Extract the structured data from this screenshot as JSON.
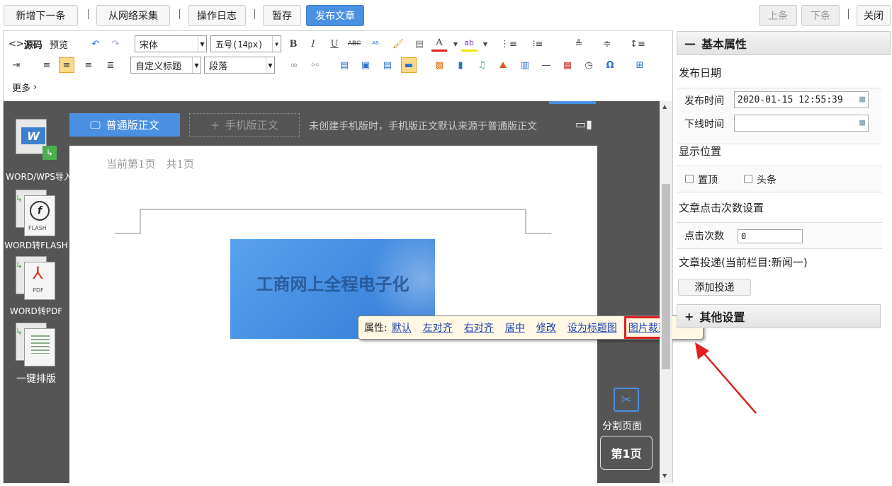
{
  "topbar": {
    "add_next": "新增下一条",
    "collect": "从网络采集",
    "log": "操作日志",
    "draft": "暂存",
    "publish": "发布文章",
    "prev": "上条",
    "next": "下条",
    "close": "关闭"
  },
  "editor_toolbar": {
    "source": "源码",
    "preview": "预览",
    "font_family": "宋体",
    "font_size": "五号(14px)",
    "custom_heading": "自定义标题",
    "paragraph": "段落",
    "more": "更多"
  },
  "left_tools": [
    {
      "label": "WORD/WPS导入",
      "icon": "word-import-icon"
    },
    {
      "label": "WORD转FLASH",
      "icon": "word-to-flash-icon"
    },
    {
      "label": "WORD转PDF",
      "icon": "word-to-pdf-icon"
    },
    {
      "label": "一键排版",
      "icon": "auto-format-icon"
    }
  ],
  "tabs": {
    "normal": "普通版正文",
    "mobile": "手机版正文",
    "hint": "未创建手机版时，手机版正文默认来源于普通版正文"
  },
  "page": {
    "info": "当前第1页　共1页",
    "image_text": "工商网上全程电子化"
  },
  "popup": {
    "label": "属性:",
    "links": [
      "默认",
      "左对齐",
      "右对齐",
      "居中",
      "修改",
      "设为标题图",
      "图片裁剪"
    ]
  },
  "split": {
    "label": "分割页面",
    "page_btn": "第1页"
  },
  "props": {
    "title": "基本属性",
    "publish_date": "发布日期",
    "publish_time_label": "发布时间",
    "publish_time": "2020-01-15 12:55:39",
    "offline_label": "下线时间",
    "offline_value": "",
    "display_pos": "显示位置",
    "top": "置顶",
    "headline": "头条",
    "click_settings": "文章点击次数设置",
    "click_label": "点击次数",
    "click_value": "0",
    "delivery": "文章投递(当前栏目:新闻一)",
    "add_delivery": "添加投递",
    "other": "其他设置"
  },
  "colors": {
    "accent": "#4a90e2",
    "dark": "#555555",
    "highlight_red": "#e02020"
  }
}
